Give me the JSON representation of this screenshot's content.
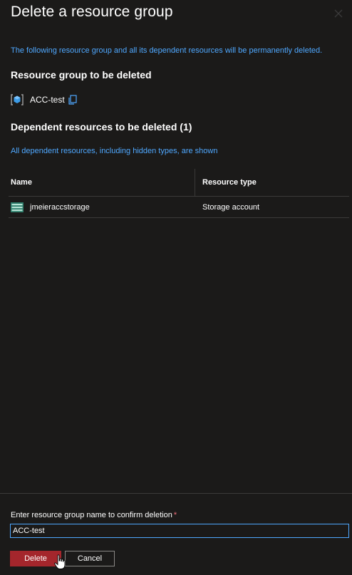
{
  "panel": {
    "title": "Delete a resource group",
    "warning": "The following resource group and all its dependent resources will be permanently deleted.",
    "rg_heading": "Resource group to be deleted",
    "rg_name": "ACC-test",
    "dependent_heading": "Dependent resources to be deleted (1)",
    "dependent_note": "All dependent resources, including hidden types, are shown"
  },
  "table": {
    "columns": [
      "Name",
      "Resource type"
    ],
    "rows": [
      {
        "name": "jmeieraccstorage",
        "type": "Storage account"
      }
    ]
  },
  "footer": {
    "confirm_label": "Enter resource group name to confirm deletion",
    "required_mark": "*",
    "confirm_value": "ACC-test",
    "delete_label": "Delete",
    "cancel_label": "Cancel"
  },
  "colors": {
    "background": "#1b1a19",
    "link_blue": "#4fa8ff",
    "danger_red": "#a4262c"
  },
  "icons": {
    "close": "close-icon",
    "resource_group": "resource-group-icon",
    "copy": "copy-icon",
    "storage": "storage-account-icon",
    "cursor": "hand-cursor-icon"
  }
}
